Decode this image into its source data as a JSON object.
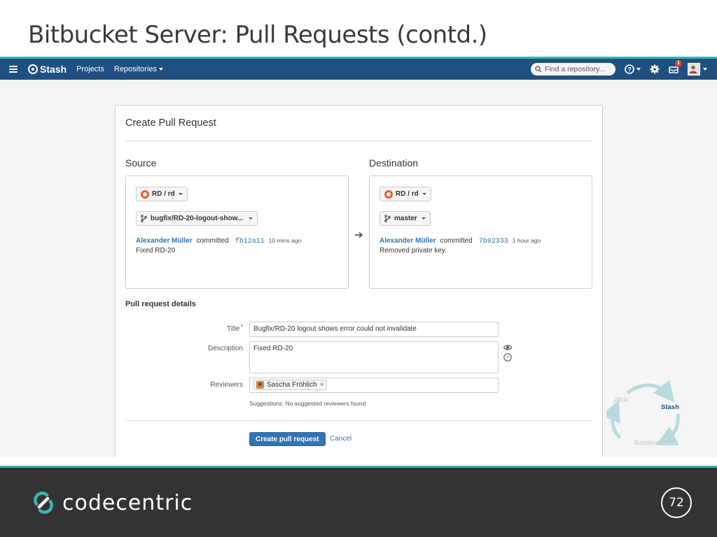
{
  "slide": {
    "title": "Bitbucket Server: Pull Requests (contd.)",
    "page_number": "72",
    "brand": "codecentric"
  },
  "navbar": {
    "logo_text": "Stash",
    "projects": "Projects",
    "repositories": "Repositories",
    "search_placeholder": "Find a repository...",
    "notification_count": "1"
  },
  "form": {
    "title": "Create Pull Request",
    "source": {
      "heading": "Source",
      "repo": "RD / rd",
      "branch": "bugfix/RD-20-logout-show...",
      "author": "Alexander Müller",
      "verb": "committed",
      "hash": "fb12a11",
      "time": "10 mins ago",
      "message": "Fixed RD-20"
    },
    "destination": {
      "heading": "Destination",
      "repo": "RD / rd",
      "branch": "master",
      "author": "Alexander Müller",
      "verb": "committed",
      "hash": "7b92333",
      "time": "1 hour ago",
      "message": "Removed private key."
    },
    "details_heading": "Pull request details",
    "title_label": "Title",
    "title_value": "Bugfix/RD-20 logout shows error could not invalidate",
    "description_label": "Description",
    "description_value": "Fixed RD-20",
    "reviewers_label": "Reviewers",
    "reviewer_name": "Sascha Fröhlich",
    "suggestions": "Suggestions: No suggested reviewers found",
    "create_button": "Create pull request",
    "cancel_link": "Cancel"
  },
  "cycle": {
    "jira": "JIRA",
    "stash": "Stash",
    "bamboo": "Bamboo"
  },
  "colors": {
    "nav_bg": "#205081",
    "accent_teal": "#3ab5b0",
    "link_blue": "#3572b0",
    "footer_bg": "#333333"
  }
}
